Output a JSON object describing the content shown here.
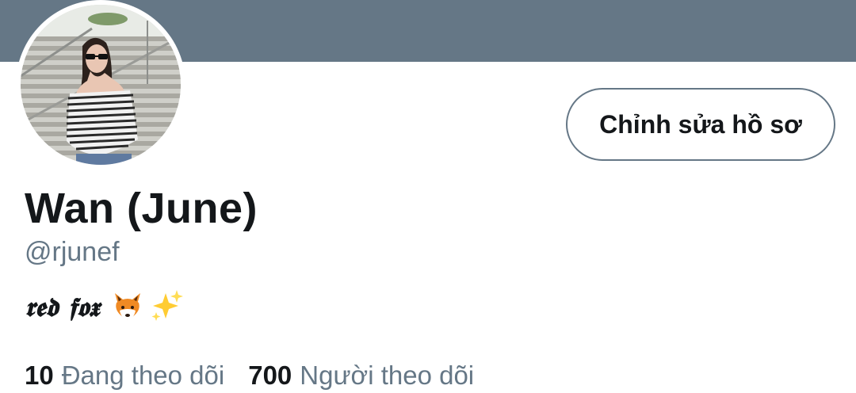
{
  "profile": {
    "display_name": "Wan (June)",
    "handle": "@rjunef",
    "bio_text": "𝖗𝖊𝖉 𝖋𝖔𝖝",
    "bio_emojis": [
      "fox-emoji",
      "sparkles-emoji"
    ],
    "edit_button_label": "Chỉnh sửa hồ sơ"
  },
  "stats": {
    "following_count": "10",
    "following_label": "Đang theo dõi",
    "followers_count": "700",
    "followers_label": "Người theo dõi"
  },
  "colors": {
    "banner": "#657786",
    "text_primary": "#14171a",
    "text_secondary": "#657786"
  }
}
